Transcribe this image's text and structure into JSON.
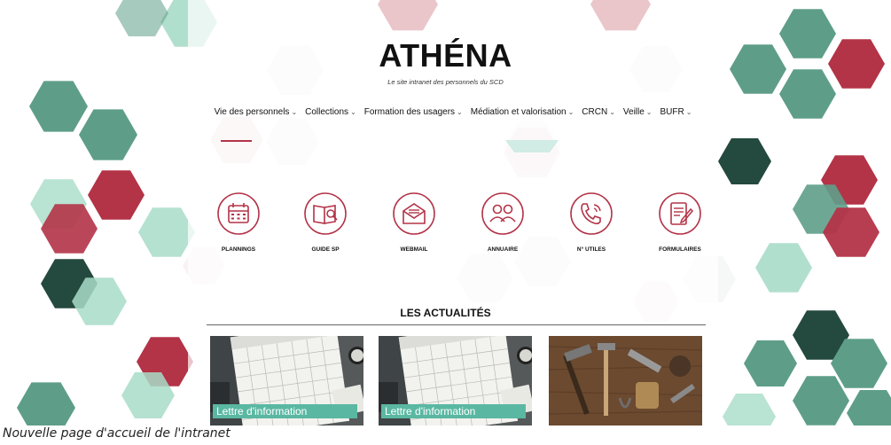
{
  "site": {
    "title": "ATHÉNA",
    "subtitle": "Le site intranet des personnels du SCD"
  },
  "nav": [
    {
      "label": "Vie des personnels"
    },
    {
      "label": "Collections"
    },
    {
      "label": "Formation des usagers"
    },
    {
      "label": "Médiation et valorisation"
    },
    {
      "label": "CRCN"
    },
    {
      "label": "Veille"
    },
    {
      "label": "BUFR"
    }
  ],
  "quick_links": [
    {
      "label": "PLANNINGS",
      "icon": "calendar-icon"
    },
    {
      "label": "GUIDE SP",
      "icon": "book-search-icon"
    },
    {
      "label": "WEBMAIL",
      "icon": "envelope-icon"
    },
    {
      "label": "ANNUAIRE",
      "icon": "people-icon"
    },
    {
      "label": "N° UTILES",
      "icon": "phone-icon"
    },
    {
      "label": "FORMULAIRES",
      "icon": "form-icon"
    }
  ],
  "news": {
    "title": "LES ACTUALITÉS",
    "cards": [
      {
        "tag": "Lettre d'information",
        "image": "calendar-desk-photo"
      },
      {
        "tag": "Lettre d'information",
        "image": "calendar-desk-photo"
      },
      {
        "image": "tools-on-wood-photo"
      }
    ]
  },
  "caption": "Nouvelle page d'accueil de l'intranet",
  "colors": {
    "accent": "#b33347",
    "teal": "#5ab8a2",
    "dark_green": "#24493f",
    "mint": "#a8dcc8"
  }
}
